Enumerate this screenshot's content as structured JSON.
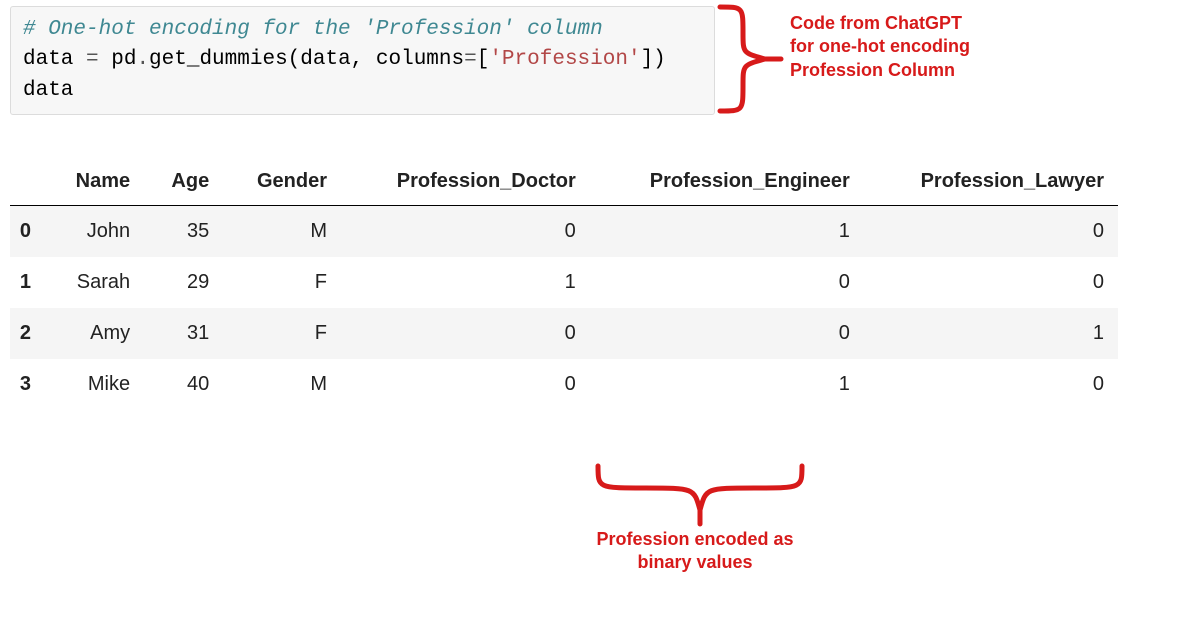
{
  "code": {
    "comment": "# One-hot encoding for the 'Profession' column",
    "line2_data": "data ",
    "line2_eq": "=",
    "line2_pd": " pd",
    "line2_dot": ".",
    "line2_func": "get_dummies",
    "line2_open": "(data, columns",
    "line2_eq2": "=",
    "line2_brack": "[",
    "line2_str": "'Profession'",
    "line2_close": "])",
    "line3": "data"
  },
  "annotation_top": {
    "l1": "Code from ChatGPT",
    "l2": "for one-hot encoding",
    "l3": "Profession Column"
  },
  "annotation_bottom": {
    "l1": "Profession encoded as",
    "l2": "binary values"
  },
  "table": {
    "headers": {
      "blank": "",
      "name": "Name",
      "age": "Age",
      "gender": "Gender",
      "p_doctor": "Profession_Doctor",
      "p_engineer": "Profession_Engineer",
      "p_lawyer": "Profession_Lawyer"
    },
    "rows": [
      {
        "idx": "0",
        "name": "John",
        "age": "35",
        "gender": "M",
        "d": "0",
        "e": "1",
        "l": "0"
      },
      {
        "idx": "1",
        "name": "Sarah",
        "age": "29",
        "gender": "F",
        "d": "1",
        "e": "0",
        "l": "0"
      },
      {
        "idx": "2",
        "name": "Amy",
        "age": "31",
        "gender": "F",
        "d": "0",
        "e": "0",
        "l": "1"
      },
      {
        "idx": "3",
        "name": "Mike",
        "age": "40",
        "gender": "M",
        "d": "0",
        "e": "1",
        "l": "0"
      }
    ]
  }
}
